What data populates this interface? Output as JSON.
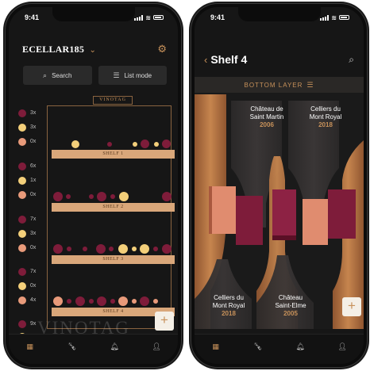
{
  "status": {
    "time": "9:41"
  },
  "colors": {
    "accent": "#c7915a",
    "red": "#7e1c3a",
    "rose": "#e89a7a",
    "white": "#f3cf7a",
    "copper": "#b57542"
  },
  "cellar": {
    "title": "ECELLAR185",
    "search_label": "Search",
    "listmode_label": "List mode",
    "brand": "VINOTAG",
    "watermark": "VINOTAG",
    "shelves": [
      {
        "label": "SHELF 1",
        "counts": {
          "red": "3x",
          "white": "3x",
          "rose": "0x"
        }
      },
      {
        "label": "SHELF 2",
        "counts": {
          "red": "6x",
          "white": "1x",
          "rose": "0x"
        }
      },
      {
        "label": "SHELF 3",
        "counts": {
          "red": "7x",
          "white": "3x",
          "rose": "0x"
        }
      },
      {
        "label": "SHELF 4",
        "counts": {
          "red": "7x",
          "white": "0x",
          "rose": "4x"
        }
      }
    ],
    "extra_count": "9x"
  },
  "detail": {
    "title": "Shelf 4",
    "layer": "BOTTOM LAYER",
    "wines": [
      {
        "name_line1": "Château de",
        "name_line2": "Saint Martin",
        "year": "2006"
      },
      {
        "name_line1": "Celliers du",
        "name_line2": "Mont Royal",
        "year": "2018"
      },
      {
        "name_line1": "Celliers du",
        "name_line2": "Mont Royal",
        "year": "2018"
      },
      {
        "name_line1": "Château",
        "name_line2": "Saint-Elme",
        "year": "2005"
      }
    ]
  },
  "tabs": [
    "cellar-tab",
    "bottle-tab",
    "notifications-tab",
    "profile-tab"
  ]
}
